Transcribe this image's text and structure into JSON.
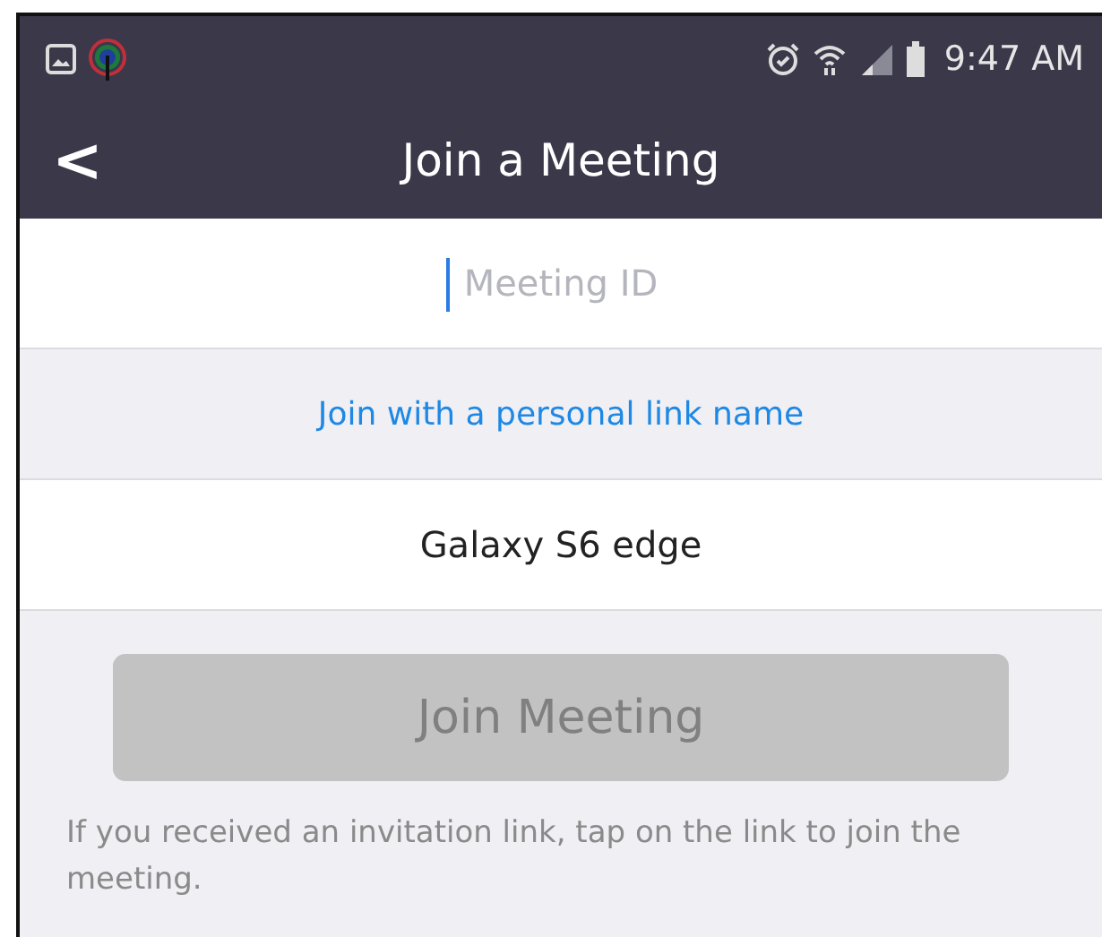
{
  "status_bar": {
    "time": "9:47 AM"
  },
  "header": {
    "back": "<",
    "title": "Join a Meeting"
  },
  "meeting_id": {
    "placeholder": "Meeting ID",
    "focused": true
  },
  "personal_link": {
    "label": "Join with a personal link name"
  },
  "name_field": {
    "value": "Galaxy S6 edge"
  },
  "join_button": {
    "label": "Join Meeting",
    "disabled": true
  },
  "hint": "If you received an invitation link, tap on the link to join the meeting."
}
